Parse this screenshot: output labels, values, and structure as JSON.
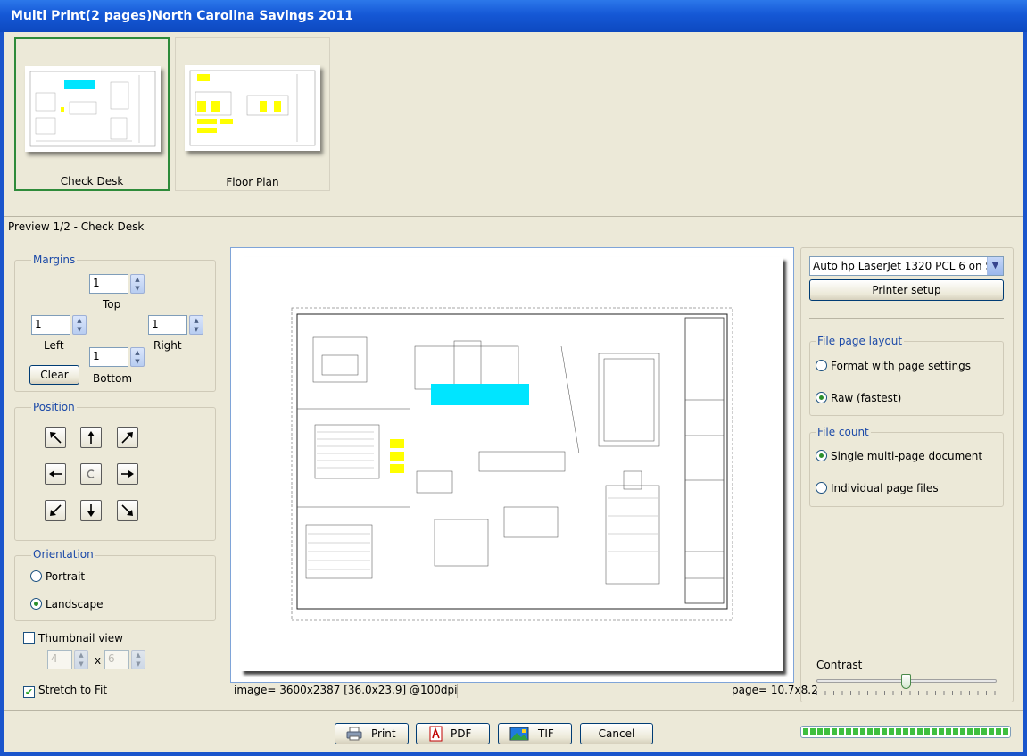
{
  "window": {
    "title": "Multi Print(2 pages)North Carolina Savings 2011"
  },
  "thumbnails": [
    {
      "label": "Check Desk",
      "selected": true
    },
    {
      "label": "Floor Plan",
      "selected": false
    }
  ],
  "preview_label": "Preview 1/2 - Check Desk",
  "margins": {
    "group_label": "Margins",
    "top": {
      "value": "1",
      "label": "Top"
    },
    "left": {
      "value": "1",
      "label": "Left"
    },
    "right": {
      "value": "1",
      "label": "Right"
    },
    "bottom": {
      "value": "1",
      "label": "Bottom"
    },
    "clear_label": "Clear"
  },
  "position": {
    "group_label": "Position",
    "buttons": [
      "arrow-up-left",
      "arrow-up",
      "arrow-up-right",
      "arrow-left",
      "center",
      "arrow-right",
      "arrow-down-left",
      "arrow-down",
      "arrow-down-right"
    ]
  },
  "orientation": {
    "group_label": "Orientation",
    "portrait": "Portrait",
    "landscape": "Landscape",
    "selected": "Landscape"
  },
  "thumbnail_view": {
    "label": "Thumbnail view",
    "checked": false,
    "cols": "4",
    "times": "x",
    "rows": "6"
  },
  "stretch_to_fit": {
    "label": "Stretch to Fit",
    "checked": true
  },
  "status": {
    "image_info": "image= 3600x2387 [36.0x23.9]  @100dpi",
    "page_info": "page= 10.7x8.2"
  },
  "printer": {
    "selected": "Auto hp LaserJet 1320 PCL 6 on S",
    "setup_label": "Printer setup"
  },
  "file_page_layout": {
    "group_label": "File page layout",
    "options": [
      "Format with page settings",
      "Raw (fastest)"
    ],
    "selected": "Raw (fastest)"
  },
  "file_count": {
    "group_label": "File count",
    "options": [
      "Single multi-page document",
      "Individual page files"
    ],
    "selected": "Single multi-page document"
  },
  "contrast": {
    "label": "Contrast",
    "level_fraction": 0.5
  },
  "actions": {
    "print": "Print",
    "pdf": "PDF",
    "tif": "TIF",
    "cancel": "Cancel"
  },
  "progress": {
    "fraction": 1.0
  },
  "colors": {
    "title_bar": "#1558d6",
    "accent_blue": "#1c4aa8",
    "selected_green": "#2e8b3a",
    "highlight_cyan": "#00e5ff",
    "highlight_yellow": "#ffff00"
  }
}
